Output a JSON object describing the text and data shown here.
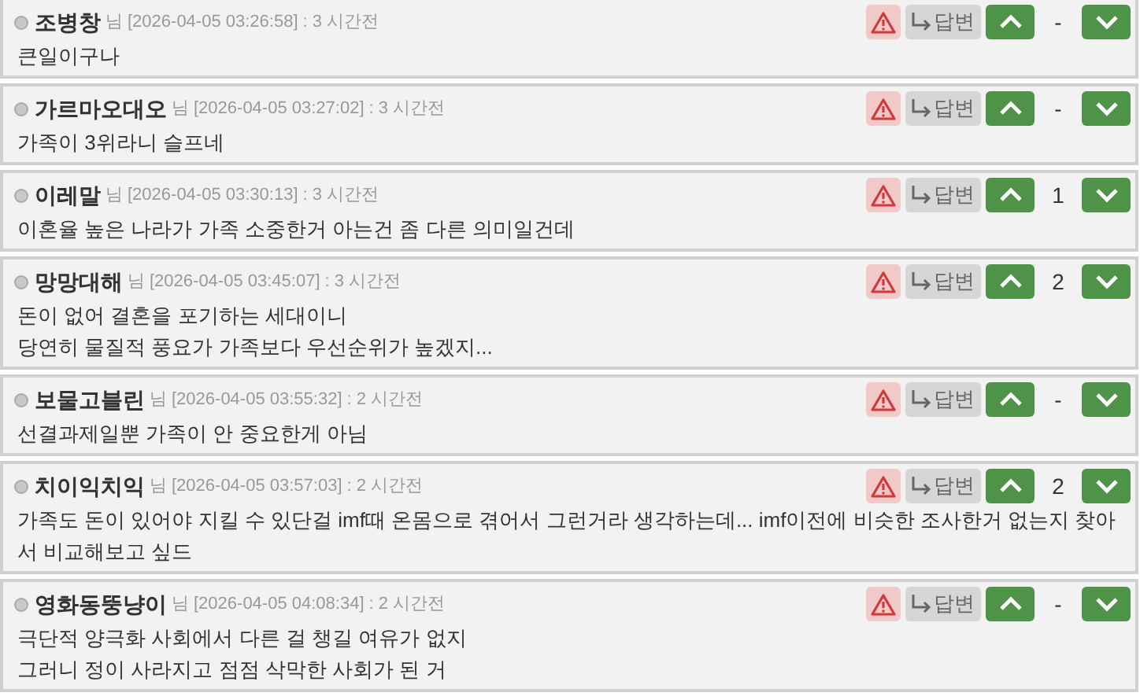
{
  "comments": [
    {
      "author": "조병창",
      "suffix": "님",
      "timestamp": "[2026-04-05 03:26:58]",
      "ago": ": 3 시간전",
      "reply": "답변",
      "score": "-",
      "lines": [
        "큰일이구나"
      ]
    },
    {
      "author": "가르마오대오",
      "suffix": "님",
      "timestamp": "[2026-04-05 03:27:02]",
      "ago": ": 3 시간전",
      "reply": "답변",
      "score": "-",
      "lines": [
        "가족이 3위라니 슬프네"
      ]
    },
    {
      "author": "이레말",
      "suffix": "님",
      "timestamp": "[2026-04-05 03:30:13]",
      "ago": ": 3 시간전",
      "reply": "답변",
      "score": "1",
      "lines": [
        "이혼율 높은 나라가 가족 소중한거 아는건 좀 다른 의미일건데"
      ]
    },
    {
      "author": "망망대해",
      "suffix": "님",
      "timestamp": "[2026-04-05 03:45:07]",
      "ago": ": 3 시간전",
      "reply": "답변",
      "score": "2",
      "lines": [
        "돈이 없어 결혼을 포기하는 세대이니",
        "당연히 물질적 풍요가 가족보다 우선순위가 높겠지..."
      ]
    },
    {
      "author": "보물고블린",
      "suffix": "님",
      "timestamp": "[2026-04-05 03:55:32]",
      "ago": ": 2 시간전",
      "reply": "답변",
      "score": "-",
      "lines": [
        "선결과제일뿐 가족이 안 중요한게 아님"
      ]
    },
    {
      "author": "치이익치익",
      "suffix": "님",
      "timestamp": "[2026-04-05 03:57:03]",
      "ago": ": 2 시간전",
      "reply": "답변",
      "score": "2",
      "lines": [
        "가족도 돈이 있어야 지킬 수 있단걸 imf때 온몸으로 겪어서 그런거라 생각하는데... imf이전에 비슷한 조사한거 없는지 찾아서 비교해보고 싶드"
      ]
    },
    {
      "author": "영화동뚱냥이",
      "suffix": "님",
      "timestamp": "[2026-04-05 04:08:34]",
      "ago": ": 2 시간전",
      "reply": "답변",
      "score": "-",
      "lines": [
        "극단적 양극화 사회에서 다른 걸 챙길 여유가 없지",
        "그러니 정이 사라지고 점점 삭막한 사회가 된 거"
      ]
    }
  ]
}
